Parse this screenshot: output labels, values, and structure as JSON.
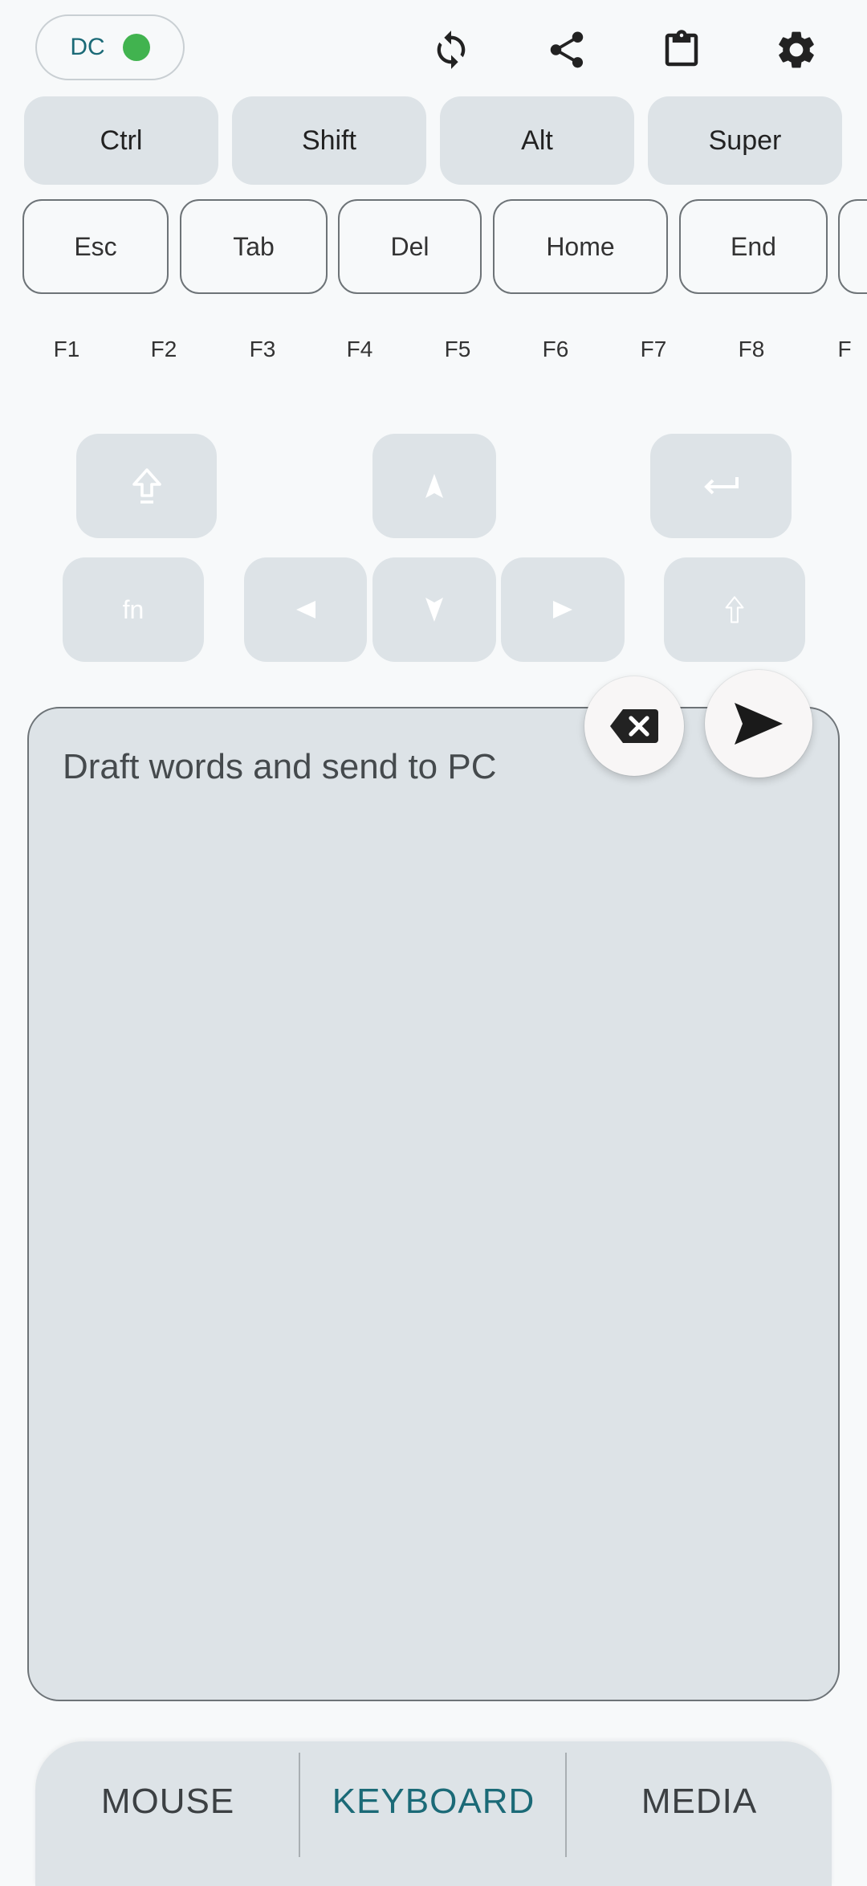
{
  "header": {
    "connection": {
      "label": "DC",
      "status_color": "#41b34f"
    },
    "icons": [
      "refresh-icon",
      "share-icon",
      "clipboard-icon",
      "settings-icon"
    ]
  },
  "modifiers": [
    "Ctrl",
    "Shift",
    "Alt",
    "Super"
  ],
  "special_keys": [
    "Esc",
    "Tab",
    "Del",
    "Home",
    "End"
  ],
  "function_keys": [
    "F1",
    "F2",
    "F3",
    "F4",
    "F5",
    "F6",
    "F7",
    "F8",
    "F"
  ],
  "pad": {
    "fn_label": "fn"
  },
  "composer": {
    "placeholder": "Draft words and send to PC"
  },
  "nav": {
    "tabs": [
      "MOUSE",
      "KEYBOARD",
      "MEDIA"
    ],
    "active": "KEYBOARD",
    "accent": "#1b6a77"
  }
}
